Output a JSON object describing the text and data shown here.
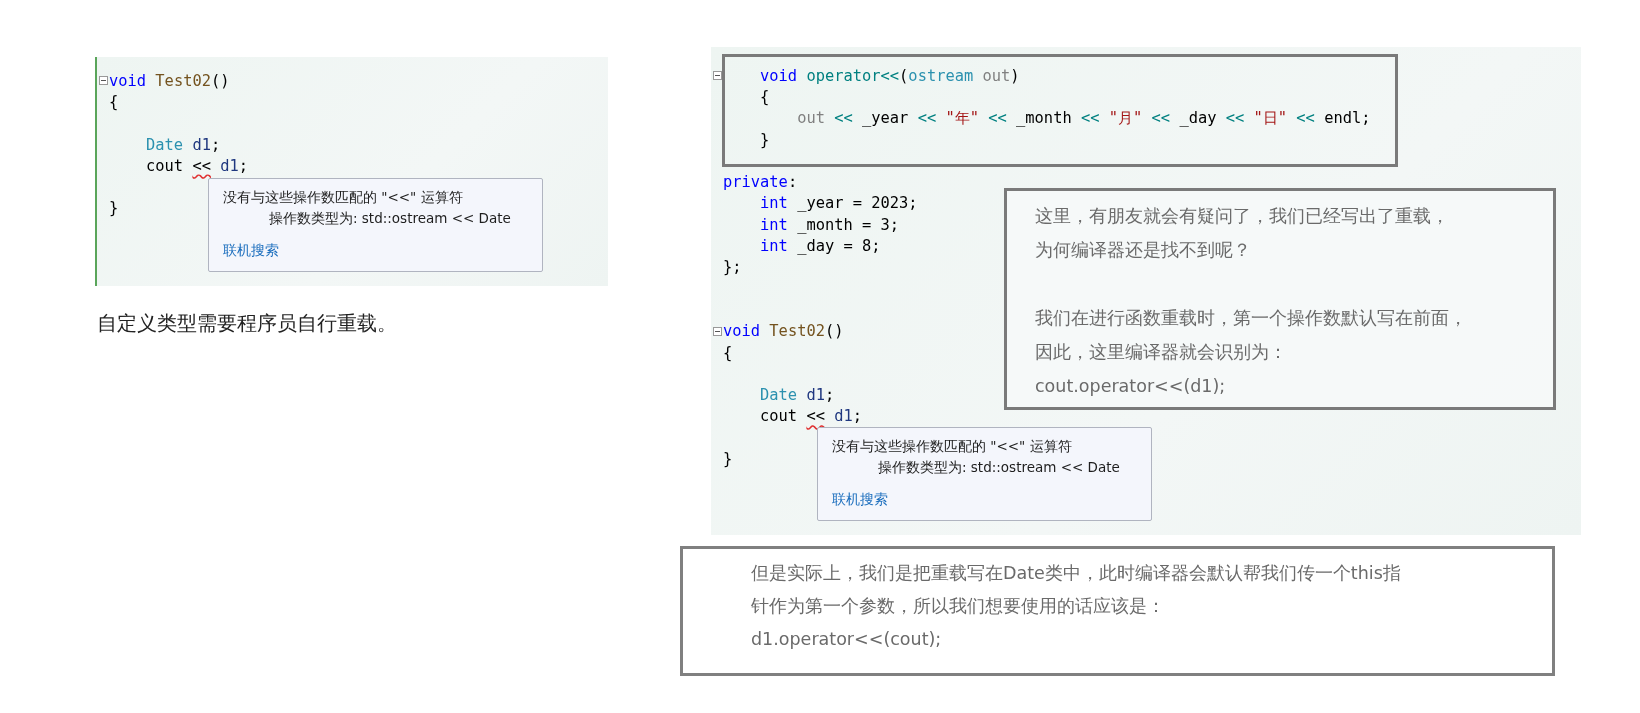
{
  "left_figure": {
    "code": [
      {
        "kind": "code",
        "fold": true,
        "tokens": [
          {
            "text": "void ",
            "kind": "keyword"
          },
          {
            "text": "Test02",
            "kind": "function"
          },
          {
            "text": "()",
            "kind": "plain"
          }
        ]
      },
      {
        "kind": "code",
        "fold": false,
        "tokens": [
          {
            "text": "{",
            "kind": "plain"
          }
        ]
      },
      {
        "kind": "blank"
      },
      {
        "kind": "code",
        "fold": false,
        "tokens": [
          {
            "text": "    Date ",
            "kind": "type"
          },
          {
            "text": "d1",
            "kind": "variable"
          },
          {
            "text": ";",
            "kind": "plain"
          }
        ]
      },
      {
        "kind": "code",
        "fold": false,
        "tokens": [
          {
            "text": "    cout ",
            "kind": "plain"
          },
          {
            "text": "<<",
            "kind": "error"
          },
          {
            "text": " d1",
            "kind": "variable"
          },
          {
            "text": ";",
            "kind": "plain"
          }
        ]
      },
      {
        "kind": "blank"
      },
      {
        "kind": "code",
        "fold": false,
        "tokens": [
          {
            "text": "}",
            "kind": "plain"
          }
        ]
      }
    ],
    "tooltip": {
      "message": "没有与这些操作数匹配的 \"<<\" 运算符",
      "detail": "操作数类型为:  std::ostream << Date",
      "link": "联机搜索"
    }
  },
  "caption": "自定义类型需要程序员自行重载。",
  "right_figure": {
    "code": [
      {
        "kind": "code",
        "fold": true,
        "tokens": [
          {
            "text": "    void ",
            "kind": "keyword"
          },
          {
            "text": "operator<<",
            "kind": "operator"
          },
          {
            "text": "(",
            "kind": "plain"
          },
          {
            "text": "ostream ",
            "kind": "type"
          },
          {
            "text": "out",
            "kind": "parameter"
          },
          {
            "text": ")",
            "kind": "plain"
          }
        ]
      },
      {
        "kind": "code",
        "fold": false,
        "tokens": [
          {
            "text": "    {",
            "kind": "plain"
          }
        ]
      },
      {
        "kind": "code",
        "fold": false,
        "tokens": [
          {
            "text": "        out ",
            "kind": "parameter"
          },
          {
            "text": "<<",
            "kind": "operator"
          },
          {
            "text": " _year ",
            "kind": "plain"
          },
          {
            "text": "<<",
            "kind": "operator"
          },
          {
            "text": " \"年\" ",
            "kind": "string"
          },
          {
            "text": "<<",
            "kind": "operator"
          },
          {
            "text": " _month ",
            "kind": "plain"
          },
          {
            "text": "<<",
            "kind": "operator"
          },
          {
            "text": " \"月\" ",
            "kind": "string"
          },
          {
            "text": "<<",
            "kind": "operator"
          },
          {
            "text": " _day ",
            "kind": "plain"
          },
          {
            "text": "<<",
            "kind": "operator"
          },
          {
            "text": " \"日\" ",
            "kind": "string"
          },
          {
            "text": "<<",
            "kind": "operator"
          },
          {
            "text": " endl;",
            "kind": "plain"
          }
        ]
      },
      {
        "kind": "code",
        "fold": false,
        "tokens": [
          {
            "text": "    }",
            "kind": "plain"
          }
        ]
      },
      {
        "kind": "blank"
      },
      {
        "kind": "code",
        "fold": false,
        "tokens": [
          {
            "text": "private",
            "kind": "keyword"
          },
          {
            "text": ":",
            "kind": "plain"
          }
        ]
      },
      {
        "kind": "code",
        "fold": false,
        "tokens": [
          {
            "text": "    int",
            "kind": "keyword"
          },
          {
            "text": " _year = 2023;",
            "kind": "plain"
          }
        ]
      },
      {
        "kind": "code",
        "fold": false,
        "tokens": [
          {
            "text": "    int",
            "kind": "keyword"
          },
          {
            "text": " _month = 3;",
            "kind": "plain"
          }
        ]
      },
      {
        "kind": "code",
        "fold": false,
        "tokens": [
          {
            "text": "    int",
            "kind": "keyword"
          },
          {
            "text": " _day = 8;",
            "kind": "plain"
          }
        ]
      },
      {
        "kind": "code",
        "fold": false,
        "tokens": [
          {
            "text": "};",
            "kind": "plain"
          }
        ]
      },
      {
        "kind": "blank"
      },
      {
        "kind": "blank"
      },
      {
        "kind": "code",
        "fold": true,
        "tokens": [
          {
            "text": "void ",
            "kind": "keyword"
          },
          {
            "text": "Test02",
            "kind": "function"
          },
          {
            "text": "()",
            "kind": "plain"
          }
        ]
      },
      {
        "kind": "code",
        "fold": false,
        "tokens": [
          {
            "text": "{",
            "kind": "plain"
          }
        ]
      },
      {
        "kind": "blank"
      },
      {
        "kind": "code",
        "fold": false,
        "tokens": [
          {
            "text": "    Date ",
            "kind": "type"
          },
          {
            "text": "d1",
            "kind": "variable"
          },
          {
            "text": ";",
            "kind": "plain"
          }
        ]
      },
      {
        "kind": "code",
        "fold": false,
        "tokens": [
          {
            "text": "    cout ",
            "kind": "plain"
          },
          {
            "text": "<<",
            "kind": "error"
          },
          {
            "text": " d1",
            "kind": "variable"
          },
          {
            "text": ";",
            "kind": "plain"
          }
        ]
      },
      {
        "kind": "blank"
      },
      {
        "kind": "code",
        "fold": false,
        "tokens": [
          {
            "text": "}",
            "kind": "plain"
          }
        ]
      }
    ],
    "tooltip": {
      "message": "没有与这些操作数匹配的 \"<<\" 运算符",
      "detail": "操作数类型为:  std::ostream << Date",
      "link": "联机搜索"
    },
    "note": {
      "paragraphs": [
        [
          "这里，有朋友就会有疑问了，我们已经写出了重载，",
          "为何编译器还是找不到呢？"
        ],
        [
          "我们在进行函数重载时，第一个操作数默认写在前面，",
          "因此，这里编译器就会识别为：",
          "cout.operator<<(d1);"
        ]
      ]
    }
  },
  "bottom_note": {
    "lines": [
      "但是实际上，我们是把重载写在Date类中，此时编译器会默认帮我们传一个this指",
      "针作为第一个参数，所以我们想要使用的话应该是：",
      "d1.operator<<(cout);"
    ]
  }
}
